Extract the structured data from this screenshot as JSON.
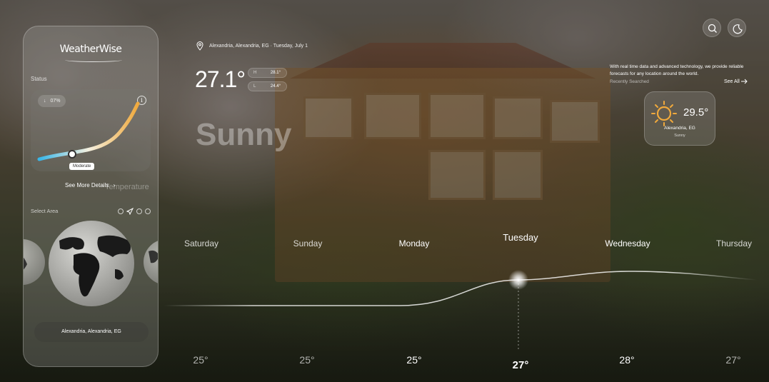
{
  "app": {
    "name": "WeatherWise"
  },
  "status": {
    "label": "Status",
    "percent": "07%",
    "level_label": "Moderate",
    "metric_label": "Temperature",
    "more_details": "See More Details"
  },
  "area": {
    "label": "Select Area",
    "selected_location": "Alexandria, Alexandria, EG"
  },
  "current": {
    "location_line": "Alexandria, Alexandria, EG · Tuesday, July 1",
    "temperature": "27.1°",
    "high": "28.1°",
    "low": "24.4°",
    "high_icon": "H",
    "low_icon": "L",
    "condition": "Sunny"
  },
  "header": {
    "tagline": "With real time data and advanced technology, we provide reliable forecasts for any location around the world.",
    "recently_searched": "Recently Searched",
    "see_all": "See All"
  },
  "recent": [
    {
      "temperature": "29.5°",
      "city": "Alexandria, EG",
      "condition": "Sunny"
    }
  ],
  "forecast": [
    {
      "day": "Saturday",
      "temp": "25°"
    },
    {
      "day": "Sunday",
      "temp": "25°"
    },
    {
      "day": "Monday",
      "temp": "25°"
    },
    {
      "day": "Tuesday",
      "temp": "27°"
    },
    {
      "day": "Wednesday",
      "temp": "28°"
    },
    {
      "day": "Thursday",
      "temp": "27°"
    }
  ],
  "colors": {
    "gauge_start": "#38b6e8",
    "gauge_mid": "#f4f0e0",
    "gauge_end": "#f0a93c",
    "sun": "#f0a93c"
  }
}
